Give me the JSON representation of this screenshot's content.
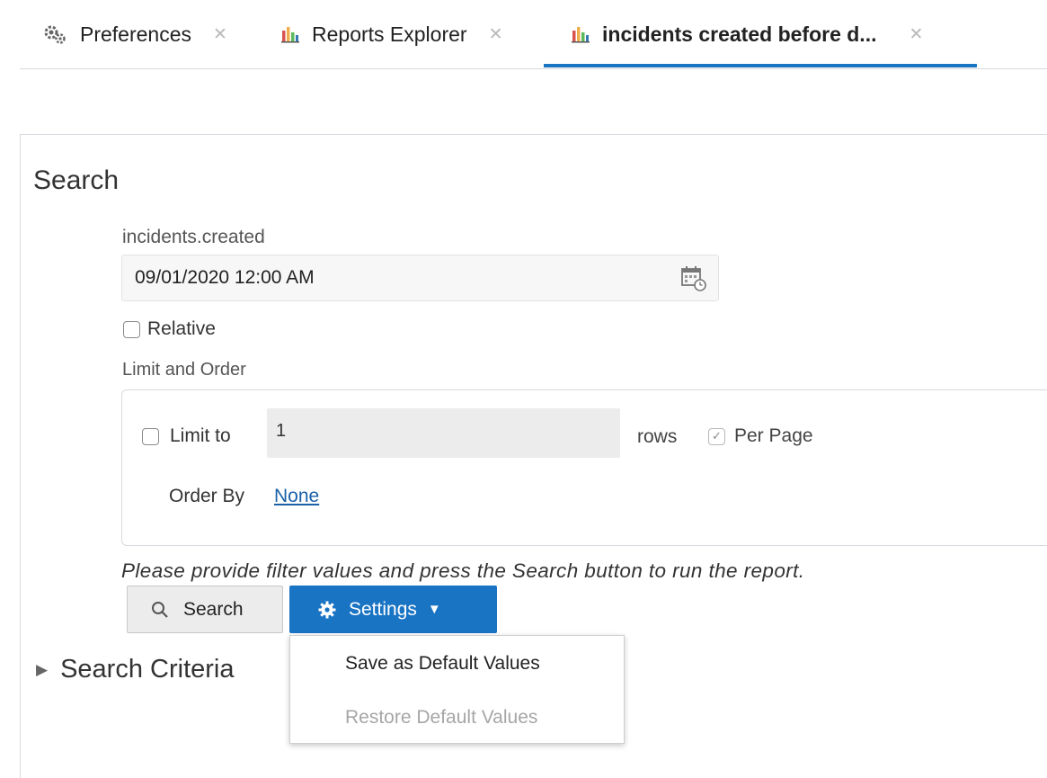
{
  "tabs": [
    {
      "label": "Preferences",
      "icon": "gear-cluster-icon",
      "active": false
    },
    {
      "label": "Reports Explorer",
      "icon": "bar-chart-icon",
      "active": false
    },
    {
      "label": "incidents created before d...",
      "icon": "bar-chart-icon",
      "active": true
    }
  ],
  "search": {
    "title": "Search",
    "field_label": "incidents.created",
    "date_value": "09/01/2020 12:00 AM",
    "relative_label": "Relative",
    "limit_order_label": "Limit and Order",
    "limit_to_label": "Limit to",
    "limit_value": "1",
    "rows_label": "rows",
    "per_page_label": "Per Page",
    "order_by_label": "Order By",
    "order_by_value": "None",
    "hint": "Please provide filter values and press the Search button to run the report."
  },
  "buttons": {
    "search_label": "Search",
    "settings_label": "Settings"
  },
  "settings_menu": {
    "items": [
      {
        "label": "Save as Default Values",
        "enabled": true
      },
      {
        "label": "Restore Default Values",
        "enabled": false
      }
    ]
  },
  "criteria": {
    "label": "Search Criteria"
  },
  "colors": {
    "accent": "#1a74c4",
    "link": "#1a61a8",
    "disabled_text": "#a6a6a6"
  }
}
